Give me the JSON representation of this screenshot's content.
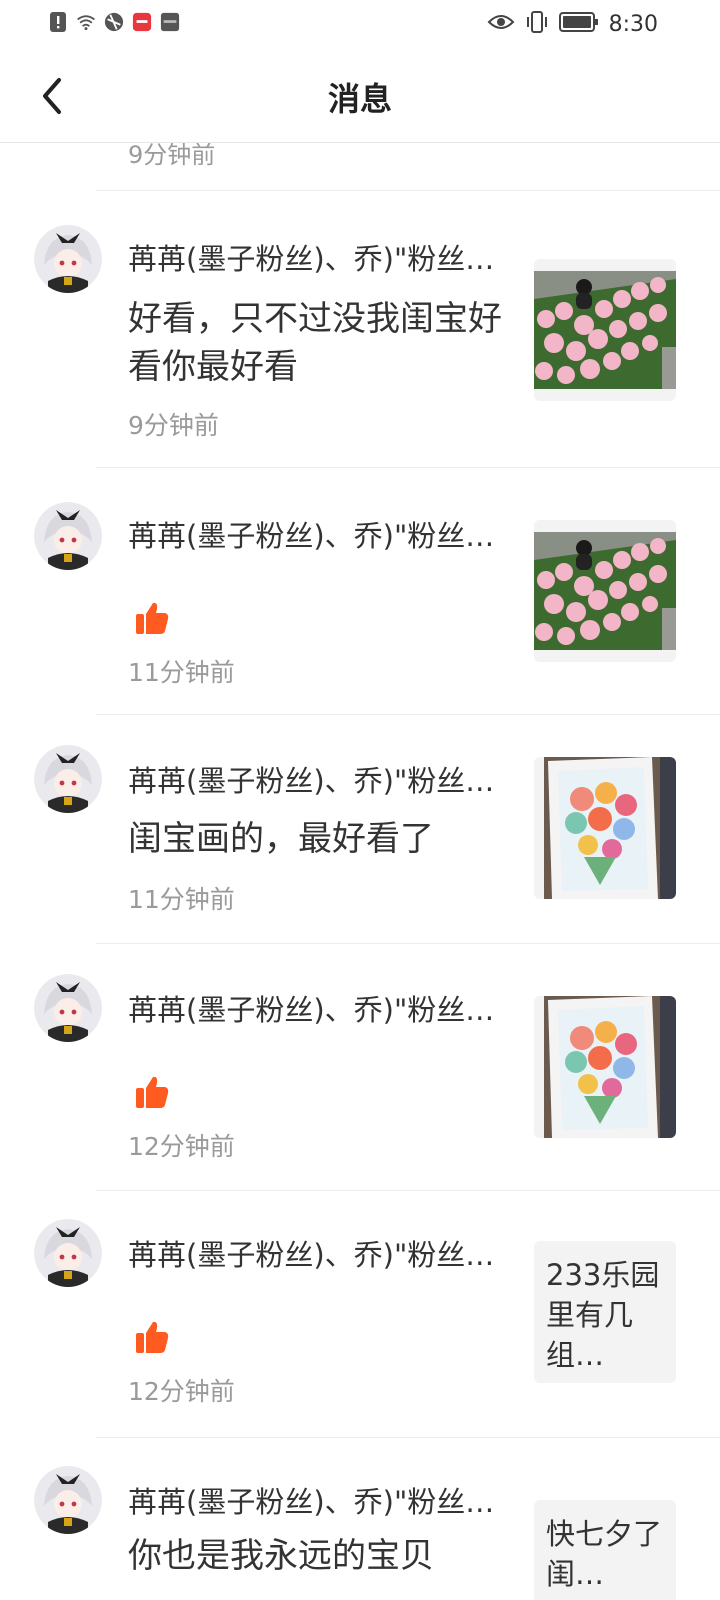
{
  "status_bar": {
    "time": "8:30",
    "left_icons": [
      "alert-icon",
      "wifi-icon",
      "app-icon",
      "mi-app-icon",
      "hms-icon"
    ],
    "right_icons": [
      "eye-icon",
      "vibrate-icon",
      "battery-icon"
    ]
  },
  "header": {
    "title": "消息",
    "back_icon": "chevron-left-icon"
  },
  "previous_item_tail": "9分钟前",
  "messages": [
    {
      "name": "苒苒(墨子粉丝)、乔)\"粉丝…",
      "text": "好看，只不过没我闺宝好看你最好看",
      "time": "9分钟前",
      "thumb_type": "image",
      "thumb_desc": "rose-field-photo"
    },
    {
      "name": "苒苒(墨子粉丝)、乔)\"粉丝…",
      "text": "",
      "like": true,
      "time": "11分钟前",
      "thumb_type": "image",
      "thumb_desc": "rose-field-photo"
    },
    {
      "name": "苒苒(墨子粉丝)、乔)\"粉丝…",
      "text": "闺宝画的，最好看了",
      "time": "11分钟前",
      "thumb_type": "image",
      "thumb_desc": "flower-painting-photo"
    },
    {
      "name": "苒苒(墨子粉丝)、乔)\"粉丝…",
      "text": "",
      "like": true,
      "time": "12分钟前",
      "thumb_type": "image",
      "thumb_desc": "flower-painting-photo"
    },
    {
      "name": "苒苒(墨子粉丝)、乔)\"粉丝…",
      "text": "",
      "like": true,
      "time": "12分钟前",
      "thumb_type": "text",
      "thumb_text": "233乐园里有几组…"
    },
    {
      "name": "苒苒(墨子粉丝)、乔)\"粉丝…",
      "text": "你也是我永远的宝贝",
      "time": "",
      "thumb_type": "text",
      "thumb_text": "快七夕了闺…"
    }
  ],
  "colors": {
    "accent_like": "#ff5a1f",
    "time_gray": "#9a9a9a",
    "divider": "#ececec"
  }
}
